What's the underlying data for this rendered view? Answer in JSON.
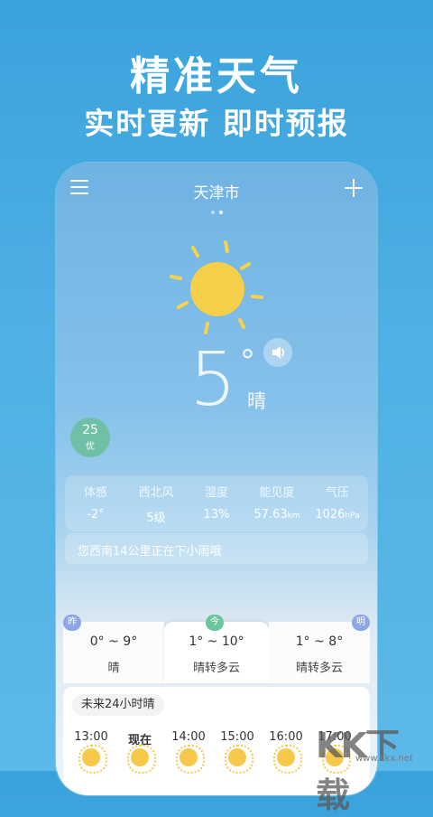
{
  "promo": {
    "title": "精准天气",
    "subtitle": "实时更新 即时预报"
  },
  "header": {
    "city": "天津市",
    "menu_icon": "hamburger-menu-icon",
    "add_icon": "plus-icon",
    "pages": 2,
    "current_page": 2
  },
  "current": {
    "temperature": "5",
    "degree_symbol": "°",
    "condition": "晴",
    "icon": "sun-icon",
    "speaker_icon": "speaker-icon",
    "aqi": {
      "value": "25",
      "label": "优",
      "color": "#6fc0a6"
    }
  },
  "details": [
    {
      "label": "体感",
      "value": "-2°",
      "unit": ""
    },
    {
      "label": "西北风",
      "value": "5级",
      "unit": ""
    },
    {
      "label": "湿度",
      "value": "13%",
      "unit": ""
    },
    {
      "label": "能见度",
      "value": "57.63",
      "unit": "km"
    },
    {
      "label": "气压",
      "value": "1026",
      "unit": "hPa"
    }
  ],
  "alert": "您西南14公里正在下小雨哦",
  "days": [
    {
      "tag": "昨",
      "range": "0° ~ 9°",
      "condition": "晴"
    },
    {
      "tag": "今",
      "range": "1° ~ 10°",
      "condition": "晴转多云"
    },
    {
      "tag": "明",
      "range": "1° ~ 8°",
      "condition": "晴转多云"
    }
  ],
  "hourly": {
    "title": "未来24小时晴",
    "hours": [
      "13:00",
      "现在",
      "14:00",
      "15:00",
      "16:00",
      "17:00"
    ],
    "icon": "sun-icon"
  },
  "watermark": {
    "text": "KK下载",
    "url": "www.kkx.net"
  },
  "colors": {
    "background": "#3aa2dc",
    "aqi_good": "#6fc0a6",
    "sun": "#f7c94b",
    "day_tag": "#8fa6e4",
    "today_tag": "#6cc79a"
  }
}
